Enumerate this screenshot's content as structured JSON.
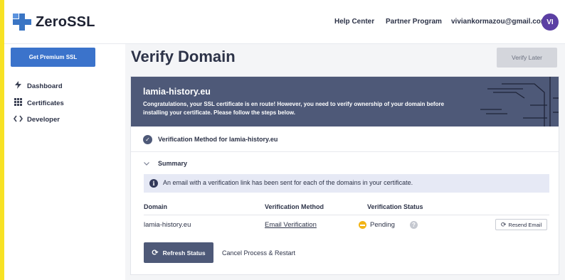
{
  "header": {
    "logo_text": "ZeroSSL",
    "links": [
      "Help Center",
      "Partner Program"
    ],
    "email": "viviankormazou@gmail.com",
    "avatar_initials": "VI"
  },
  "sidebar": {
    "premium_button": "Get Premium SSL",
    "items": [
      {
        "label": "Dashboard",
        "icon": "bolt-icon"
      },
      {
        "label": "Certificates",
        "icon": "grid-icon"
      },
      {
        "label": "Developer",
        "icon": "code-icon"
      }
    ]
  },
  "main": {
    "title": "Verify Domain",
    "verify_later": "Verify Later",
    "banner": {
      "domain": "lamia-history.eu",
      "text": "Congratulations, your SSL certificate is en route! However, you need to verify ownership of your domain before installing your certificate. Please follow the steps below."
    },
    "method_label": "Verification Method for lamia-history.eu",
    "summary_label": "Summary",
    "info_text": "An email with a verification link has been sent for each of the domains in your certificate.",
    "table": {
      "headers": [
        "Domain",
        "Verification Method",
        "Verification Status"
      ],
      "rows": [
        {
          "domain": "lamia-history.eu",
          "method": "Email Verification",
          "status": "Pending"
        }
      ]
    },
    "resend_button": "Resend Email",
    "refresh_button": "Refresh Status",
    "cancel_link": "Cancel Process & Restart"
  },
  "colors": {
    "accent": "#3b73cb",
    "banner": "#4e5978",
    "pending": "#f2b416",
    "avatar": "#5b3fa3",
    "left_stripe": "#f7e224"
  }
}
